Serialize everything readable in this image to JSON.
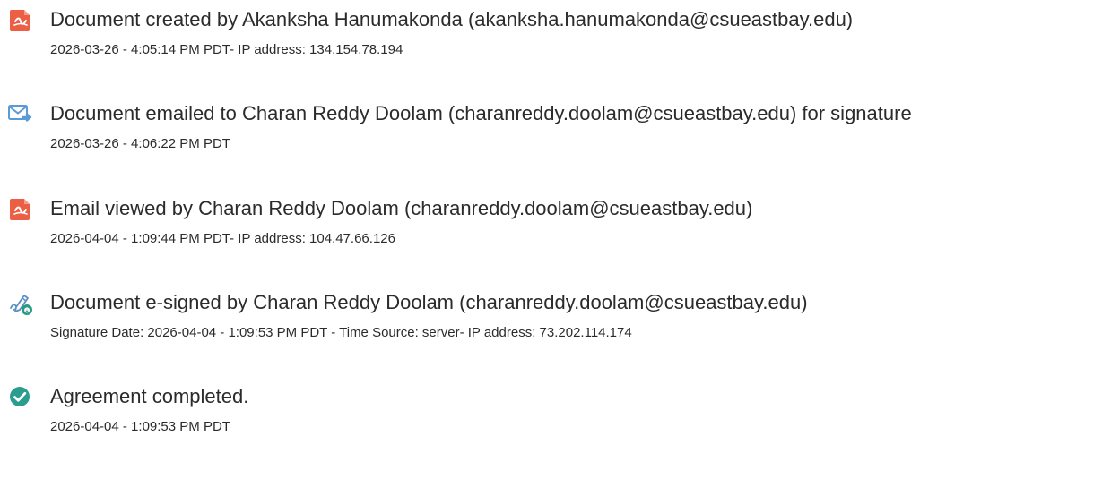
{
  "colors": {
    "adobe_red": "#ec5f45",
    "email_blue": "#5b9bd5",
    "sign_blue": "#5b8fc7",
    "sign_green": "#2c9a83",
    "check_teal": "#2a9d8f",
    "text": "#2b2b2b"
  },
  "events": [
    {
      "icon": "document-created-icon",
      "title": "Document created by Akanksha Hanumakonda (akanksha.hanumakonda@csueastbay.edu)",
      "detail": "2026-03-26 - 4:05:14 PM PDT- IP address: 134.154.78.194"
    },
    {
      "icon": "email-sent-icon",
      "title": "Document emailed to Charan Reddy Doolam (charanreddy.doolam@csueastbay.edu) for signature",
      "detail": "2026-03-26 - 4:06:22 PM PDT"
    },
    {
      "icon": "email-viewed-icon",
      "title": "Email viewed by Charan Reddy Doolam (charanreddy.doolam@csueastbay.edu)",
      "detail": "2026-04-04 - 1:09:44 PM PDT- IP address: 104.47.66.126"
    },
    {
      "icon": "e-sign-pen-icon",
      "title": "Document e-signed by Charan Reddy Doolam (charanreddy.doolam@csueastbay.edu)",
      "detail": "Signature Date: 2026-04-04 - 1:09:53 PM PDT - Time Source: server- IP address: 73.202.114.174"
    },
    {
      "icon": "checkmark-circle-icon",
      "title": "Agreement completed.",
      "detail": "2026-04-04 - 1:09:53 PM PDT"
    }
  ]
}
